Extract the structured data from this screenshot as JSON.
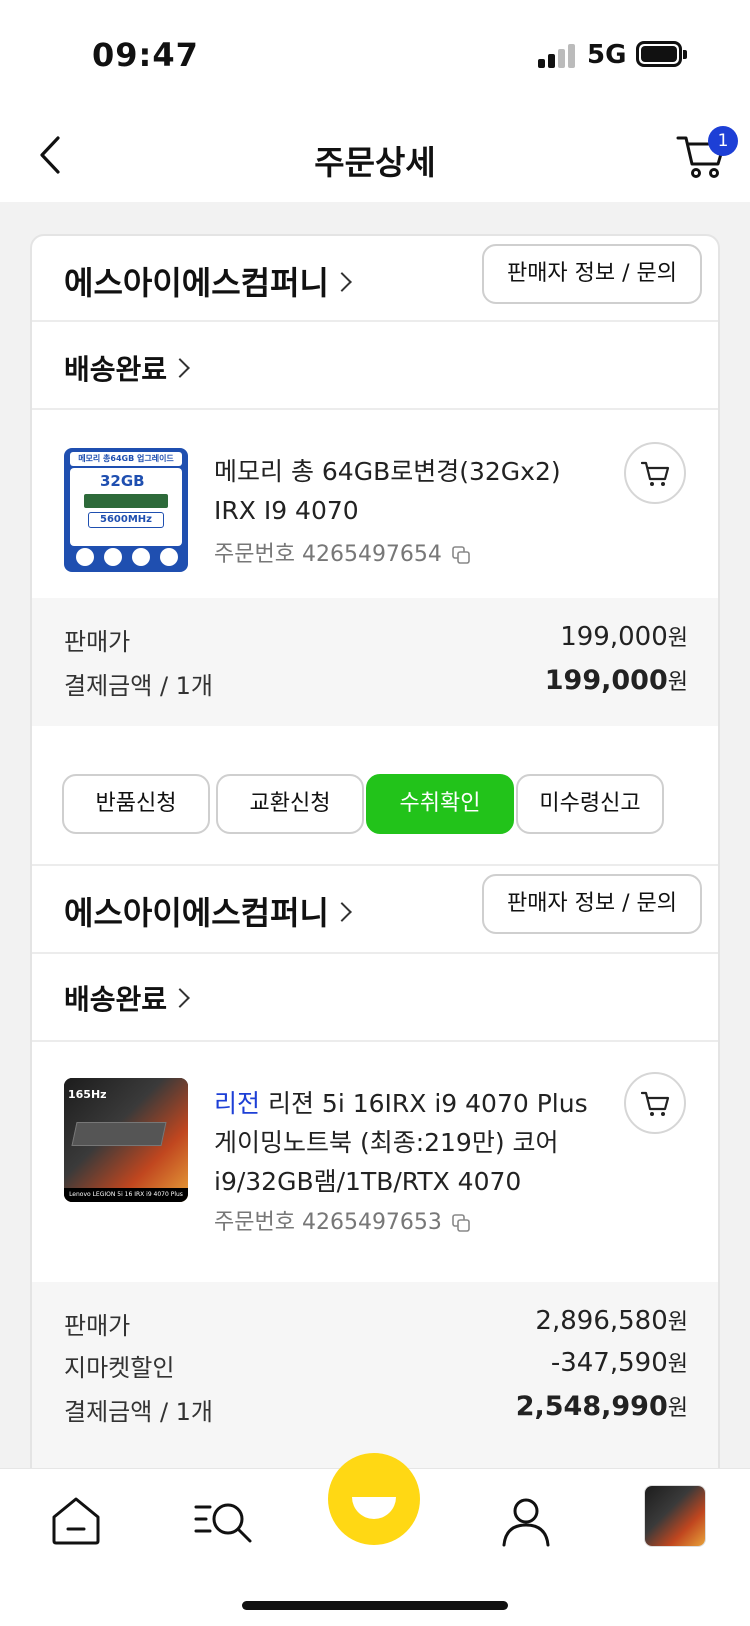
{
  "status_bar": {
    "time": "09:47",
    "network": "5G"
  },
  "header": {
    "title": "주문상세",
    "cart_count": "1"
  },
  "orders": [
    {
      "shop_name": "에스아이에스컴퍼니",
      "seller_button": "판매자 정보 / 문의",
      "delivery_status": "배송완료",
      "product": {
        "brand": "",
        "name": "메모리 총 64GB로변경(32Gx2) IRX I9 4070",
        "order_no": "주문번호 4265497654",
        "thumb_title": "메모리 총64GB 업그레이드",
        "thumb_capacity": "32GB",
        "thumb_speed": "5600MHz"
      },
      "prices": [
        {
          "label": "판매가",
          "value": "199,000",
          "unit": "원"
        },
        {
          "label": "결제금액 / 1개",
          "value": "199,000",
          "unit": "원"
        }
      ],
      "actions": [
        "반품신청",
        "교환신청",
        "수취확인",
        "미수령신고"
      ]
    },
    {
      "shop_name": "에스아이에스컴퍼니",
      "seller_button": "판매자 정보 / 문의",
      "delivery_status": "배송완료",
      "product": {
        "brand": "리전",
        "name": " 리젼 5i 16IRX i9 4070 Plus 게이밍노트북 (최종:219만) 코어i9/32GB램/1TB/RTX 4070",
        "order_no": "주문번호 4265497653",
        "thumb_badge": "165Hz",
        "thumb_caption": "Lenovo LEGION 5i 16 IRX i9 4070 Plus"
      },
      "prices": [
        {
          "label": "판매가",
          "value": "2,896,580",
          "unit": "원"
        },
        {
          "label": "지마켓할인",
          "value": "-347,590",
          "unit": "원"
        },
        {
          "label": "결제금액 / 1개",
          "value": "2,548,990",
          "unit": "원"
        }
      ]
    }
  ],
  "bottom_nav": [
    "home-icon",
    "category-search-icon",
    "smile-icon",
    "profile-icon",
    "recent-product-thumbnail"
  ],
  "colors": {
    "accent_blue": "#1d3fd6",
    "confirm_green": "#22c31a",
    "smile_yellow": "#ffd814"
  }
}
